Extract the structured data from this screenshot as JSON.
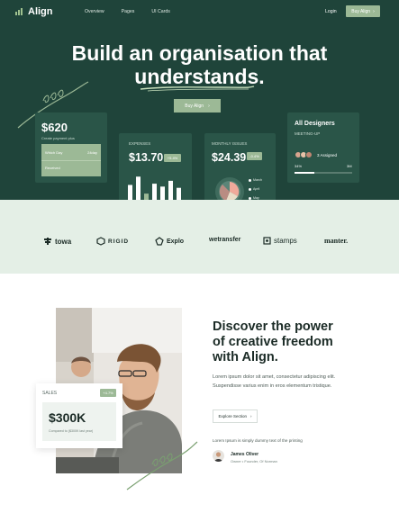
{
  "nav": {
    "logo": "Align",
    "links": [
      "Overview",
      "Pages",
      "UI Cards"
    ],
    "login": "Login",
    "cta": "Buy Align"
  },
  "hero": {
    "headline_line1": "Build an organisation that",
    "headline_line2": "understands.",
    "cta": "Buy Align"
  },
  "cards": {
    "payment": {
      "amount": "$620",
      "label": "Create payment plus",
      "rows": [
        {
          "name": "Which Day",
          "value": "24day"
        },
        {
          "name": "Received",
          "value": ""
        }
      ]
    },
    "expenses": {
      "title": "EXPENSES",
      "amount": "$13.70",
      "badge": "+5.4%",
      "bars": [
        0.62,
        0.82,
        0.41,
        0.65,
        0.58,
        0.72,
        0.55
      ]
    },
    "monthly": {
      "title": "MONTHLY ISSUES",
      "amount": "$24.39",
      "badge": "-0.4%",
      "legend": [
        "March",
        "April",
        "May"
      ]
    },
    "designers": {
      "title": "All Designers",
      "subtitle": "MEETING-UP",
      "assigned": "3 Assigned",
      "percent": "34%",
      "days": "3M",
      "progress": 0.34
    }
  },
  "logos": [
    "towa",
    "RIGID",
    "Explo",
    "wetransfer",
    "stamps",
    "manter."
  ],
  "sales": {
    "title": "SALES",
    "badge": "+4.7%",
    "amount": "$300K",
    "compare": "Compared to ($300K last year)"
  },
  "discover": {
    "heading": "Discover the power of creative freedom with Align.",
    "body": "Lorem ipsum dolor sit amet, consectetur adipiscing elit. Suspendisse varius enim in eros elementum tristique.",
    "button": "Explore Section",
    "note": "Lorem Ipsum is simply dummy text of the printing",
    "author_name": "James Oliver",
    "author_role": "Owner • Founder, Of Norman"
  },
  "colors": {
    "hero_bg": "#1f443a",
    "card_bg": "#2a5548",
    "accent": "#9cb996",
    "band_bg": "#e4efe6"
  }
}
